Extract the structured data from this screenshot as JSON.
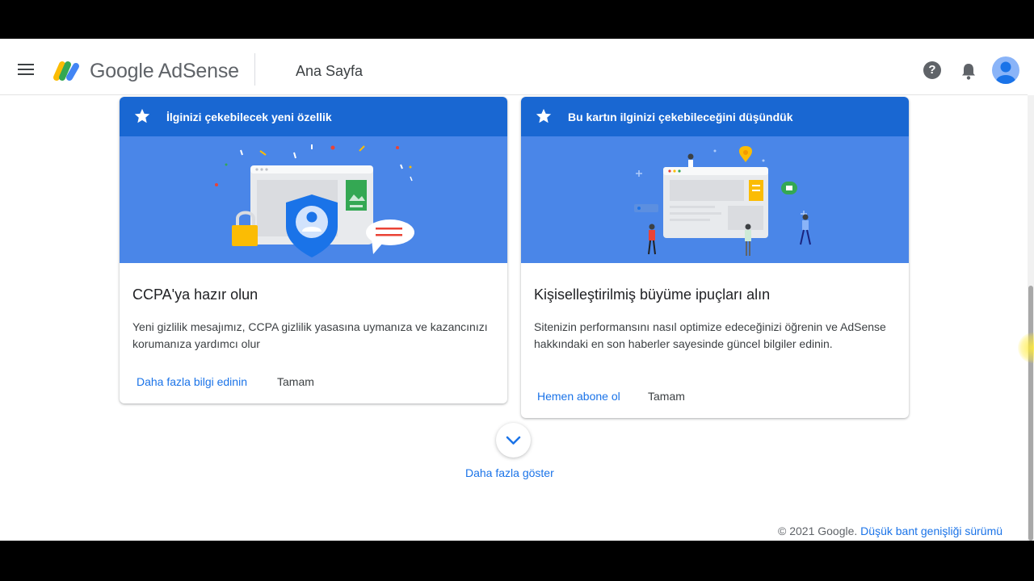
{
  "header": {
    "brand": "Google AdSense",
    "page_title": "Ana Sayfa",
    "help_glyph": "?"
  },
  "cards": [
    {
      "banner": "İlginizi çekebilecek yeni özellik",
      "title": "CCPA'ya hazır olun",
      "description": "Yeni gizlilik mesajımız, CCPA gizlilik yasasına uymanıza ve kazancınızı korumanıza yardımcı olur",
      "link": "Daha fazla bilgi edinin",
      "dismiss": "Tamam"
    },
    {
      "banner": "Bu kartın ilginizi çekebileceğini düşündük",
      "title": "Kişiselleştirilmiş büyüme ipuçları alın",
      "description": "Sitenizin performansını nasıl optimize edeceğinizi öğrenin ve AdSense hakkındaki en son haberler sayesinde güncel bilgiler edinin.",
      "link": "Hemen abone ol",
      "dismiss": "Tamam"
    }
  ],
  "show_more": "Daha fazla göster",
  "footer": {
    "copyright": "© 2021 Google.",
    "low_bandwidth": "Düşük bant genişliği sürümü"
  },
  "colors": {
    "banner": "#1967d2",
    "illustration_bg": "#4a86e8",
    "link": "#1a73e8"
  },
  "icons": [
    "menu-icon",
    "adsense-logo-icon",
    "help-icon",
    "bell-icon",
    "avatar-icon",
    "star-icon",
    "chevron-down-icon"
  ]
}
